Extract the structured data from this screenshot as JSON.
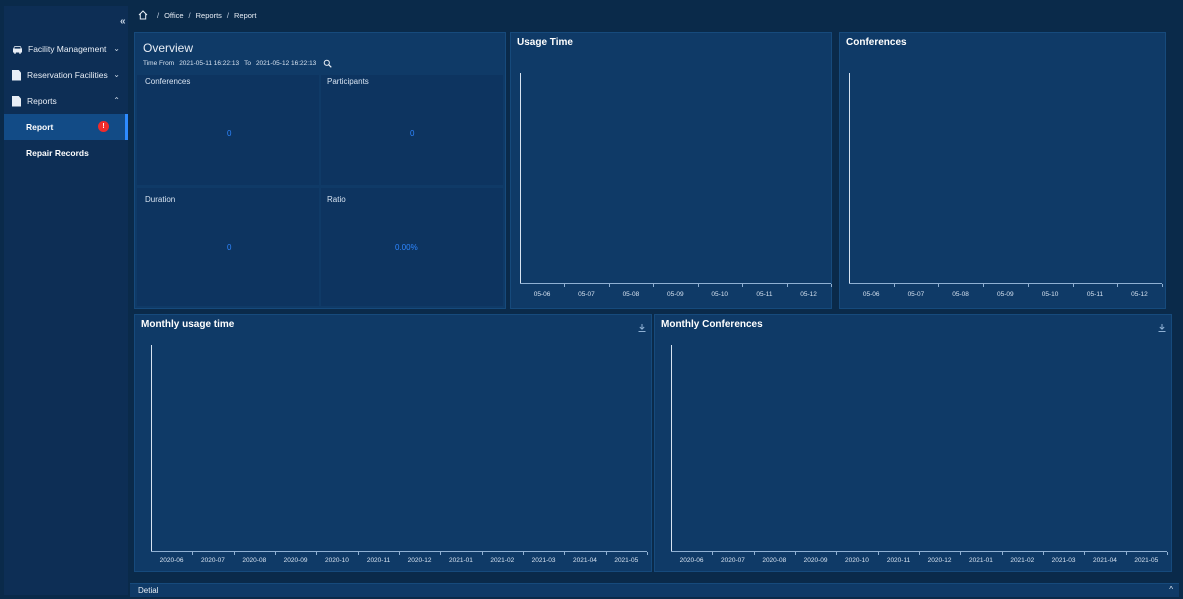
{
  "sidebar": {
    "collapse_label": "«",
    "items": [
      {
        "label": "Facility Management",
        "icon": "car-icon"
      },
      {
        "label": "Reservation Facilities",
        "icon": "document-icon"
      },
      {
        "label": "Reports",
        "icon": "document-icon"
      }
    ],
    "sub_items": [
      {
        "label": "Report",
        "badge": "!"
      },
      {
        "label": "Repair Records"
      }
    ]
  },
  "breadcrumb": {
    "items": [
      "Office",
      "Reports",
      "Report"
    ],
    "sep": "/"
  },
  "overview": {
    "title": "Overview",
    "time_from_label": "Time From",
    "time_from": "2021-05-11 16:22:13",
    "to_label": "To",
    "time_to": "2021-05-12 16:22:13",
    "stats": [
      {
        "label": "Conferences",
        "value": "0"
      },
      {
        "label": "Participants",
        "value": "0"
      },
      {
        "label": "Duration",
        "value": "0"
      },
      {
        "label": "Ratio",
        "value": "0.00%"
      }
    ]
  },
  "colors": {
    "background": "#0a2a4a",
    "panel": "#0f3a67",
    "accent": "#2e86ff",
    "badge": "#f02b2b"
  },
  "chart_data": [
    {
      "type": "line",
      "title": "Usage Time",
      "categories": [
        "05-06",
        "05-07",
        "05-08",
        "05-09",
        "05-10",
        "05-11",
        "05-12"
      ],
      "series": []
    },
    {
      "type": "line",
      "title": "Conferences",
      "categories": [
        "05-06",
        "05-07",
        "05-08",
        "05-09",
        "05-10",
        "05-11",
        "05-12"
      ],
      "series": []
    },
    {
      "type": "line",
      "title": "Monthly usage time",
      "categories": [
        "2020-06",
        "2020-07",
        "2020-08",
        "2020-09",
        "2020-10",
        "2020-11",
        "2020-12",
        "2021-01",
        "2021-02",
        "2021-03",
        "2021-04",
        "2021-05"
      ],
      "series": []
    },
    {
      "type": "line",
      "title": "Monthly Conferences",
      "categories": [
        "2020-06",
        "2020-07",
        "2020-08",
        "2020-09",
        "2020-10",
        "2020-11",
        "2020-12",
        "2021-01",
        "2021-02",
        "2021-03",
        "2021-04",
        "2021-05"
      ],
      "series": []
    }
  ],
  "footer": {
    "label": "Detial",
    "toggle": "^"
  }
}
